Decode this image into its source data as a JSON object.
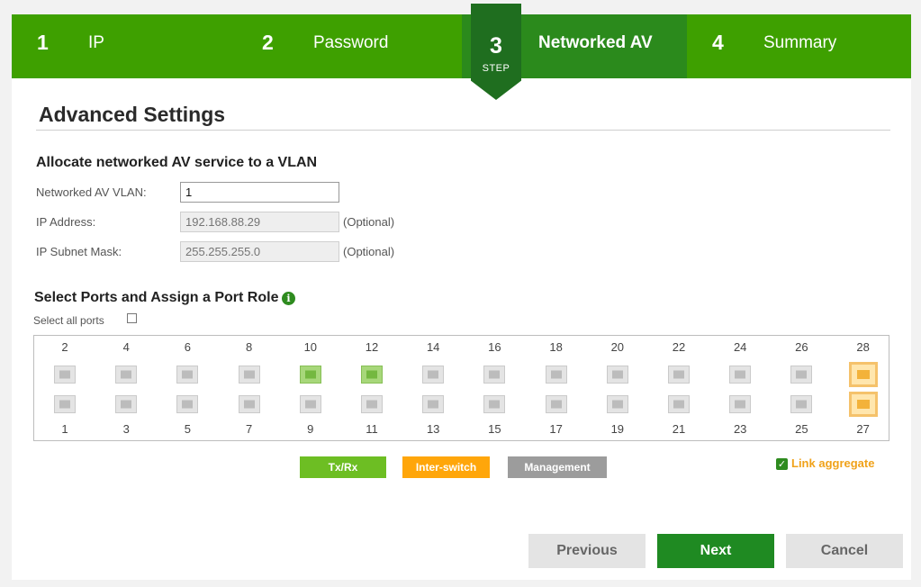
{
  "stepper": {
    "steps": [
      {
        "num": "1",
        "label": "IP"
      },
      {
        "num": "2",
        "label": "Password"
      },
      {
        "num": "3",
        "label": "Networked AV",
        "badge_caption": "STEP"
      },
      {
        "num": "4",
        "label": "Summary"
      }
    ]
  },
  "page_title": "Advanced Settings",
  "vlan_section": {
    "title": "Allocate networked AV service to a VLAN",
    "vlan_label": "Networked AV VLAN:",
    "vlan_value": "1",
    "ip_label": "IP Address:",
    "ip_placeholder": "192.168.88.29",
    "ip_optional": "(Optional)",
    "mask_label": "IP Subnet Mask:",
    "mask_placeholder": "255.255.255.0",
    "mask_optional": "(Optional)"
  },
  "ports_section": {
    "title": "Select Ports and Assign a Port Role",
    "info_icon": "info-icon",
    "select_all_label": "Select all ports",
    "select_all_checked": false,
    "top_row": [
      {
        "num": "2",
        "role": "none"
      },
      {
        "num": "4",
        "role": "none"
      },
      {
        "num": "6",
        "role": "none"
      },
      {
        "num": "8",
        "role": "none"
      },
      {
        "num": "10",
        "role": "txrx"
      },
      {
        "num": "12",
        "role": "txrx"
      },
      {
        "num": "14",
        "role": "none"
      },
      {
        "num": "16",
        "role": "none"
      },
      {
        "num": "18",
        "role": "none"
      },
      {
        "num": "20",
        "role": "none"
      },
      {
        "num": "22",
        "role": "none"
      },
      {
        "num": "24",
        "role": "none"
      },
      {
        "num": "26",
        "role": "none"
      },
      {
        "num": "28",
        "role": "inter-switch"
      }
    ],
    "bottom_row": [
      {
        "num": "1",
        "role": "none"
      },
      {
        "num": "3",
        "role": "none"
      },
      {
        "num": "5",
        "role": "none"
      },
      {
        "num": "7",
        "role": "none"
      },
      {
        "num": "9",
        "role": "none"
      },
      {
        "num": "11",
        "role": "none"
      },
      {
        "num": "13",
        "role": "none"
      },
      {
        "num": "15",
        "role": "none"
      },
      {
        "num": "17",
        "role": "none"
      },
      {
        "num": "19",
        "role": "none"
      },
      {
        "num": "21",
        "role": "none"
      },
      {
        "num": "23",
        "role": "none"
      },
      {
        "num": "25",
        "role": "none"
      },
      {
        "num": "27",
        "role": "inter-switch"
      }
    ]
  },
  "legend": {
    "txrx": "Tx/Rx",
    "inter_switch": "Inter-switch",
    "management": "Management"
  },
  "link_aggregate": {
    "label": "Link aggregate",
    "checked": true
  },
  "buttons": {
    "previous": "Previous",
    "next": "Next",
    "cancel": "Cancel"
  },
  "colors": {
    "header_green": "#3ea000",
    "active_step": "#2b8a1c",
    "step_badge": "#1f6e1f",
    "txrx": "#6dbe23",
    "inter_switch": "#ffa60a",
    "management": "#9c9c9c",
    "next_button": "#1f8a22"
  }
}
